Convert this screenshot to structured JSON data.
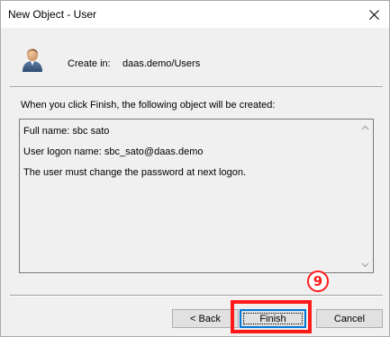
{
  "window": {
    "title": "New Object - User",
    "close_glyph": "✕"
  },
  "header": {
    "create_in_label": "Create in:",
    "create_in_path": "daas.demo/Users",
    "icon": "user-icon"
  },
  "description": "When you click Finish, the following object will be created:",
  "summary": {
    "lines": [
      "Full name: sbc sato",
      "User logon name: sbc_sato@daas.demo",
      "The user must change the password at next logon."
    ]
  },
  "buttons": {
    "back_label": "< Back",
    "finish_label": "Finish",
    "cancel_label": "Cancel"
  },
  "annotation": {
    "step_number": "9",
    "color": "#ff1a1a"
  },
  "colors": {
    "window_bg": "#f0f0f0",
    "focus_blue": "#0078d7"
  }
}
